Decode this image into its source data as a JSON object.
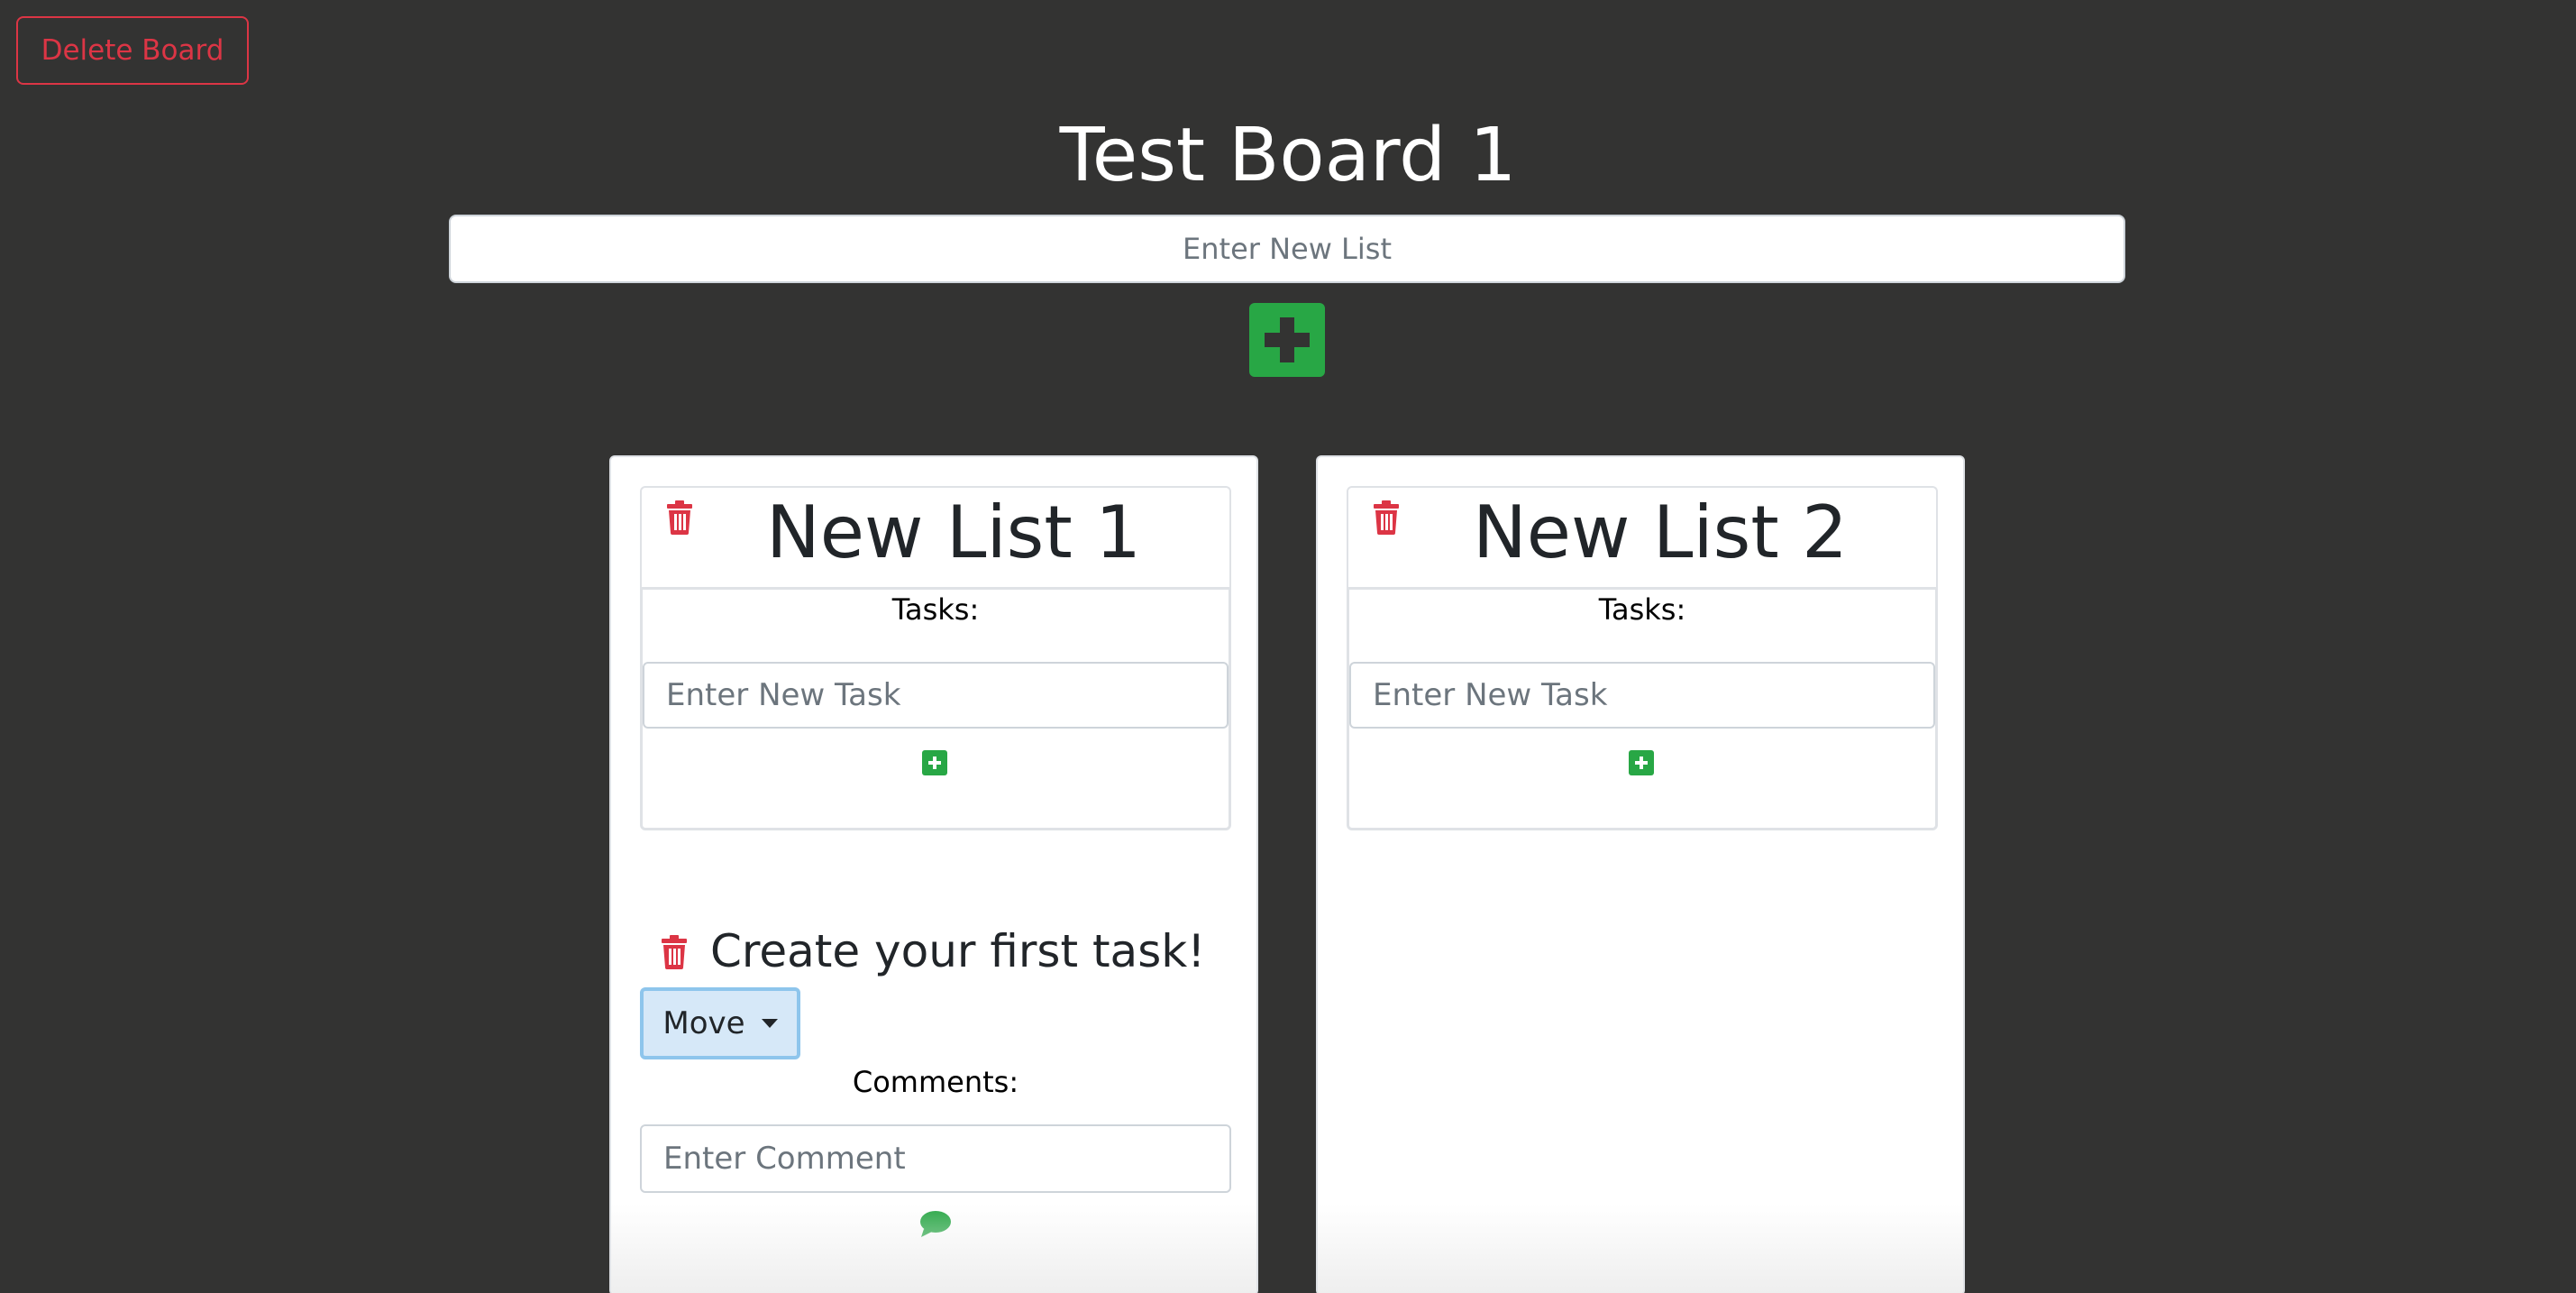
{
  "board": {
    "delete_label": "Delete Board",
    "title": "Test Board 1",
    "new_list_placeholder": "Enter New List",
    "add_list_icon": "plus-square-icon"
  },
  "lists": [
    {
      "title": "New List 1",
      "tasks_label": "Tasks:",
      "new_task_placeholder": "Enter New Task",
      "tasks": [
        {
          "title": "Create your first task!",
          "move_label": "Move",
          "comments_label": "Comments:",
          "comment_placeholder": "Enter Comment"
        }
      ]
    },
    {
      "title": "New List 2",
      "tasks_label": "Tasks:",
      "new_task_placeholder": "Enter New Task",
      "tasks": []
    }
  ],
  "colors": {
    "background": "#333332",
    "danger": "#dc3545",
    "success": "#28a745",
    "move_button": "#d6e8f8"
  }
}
